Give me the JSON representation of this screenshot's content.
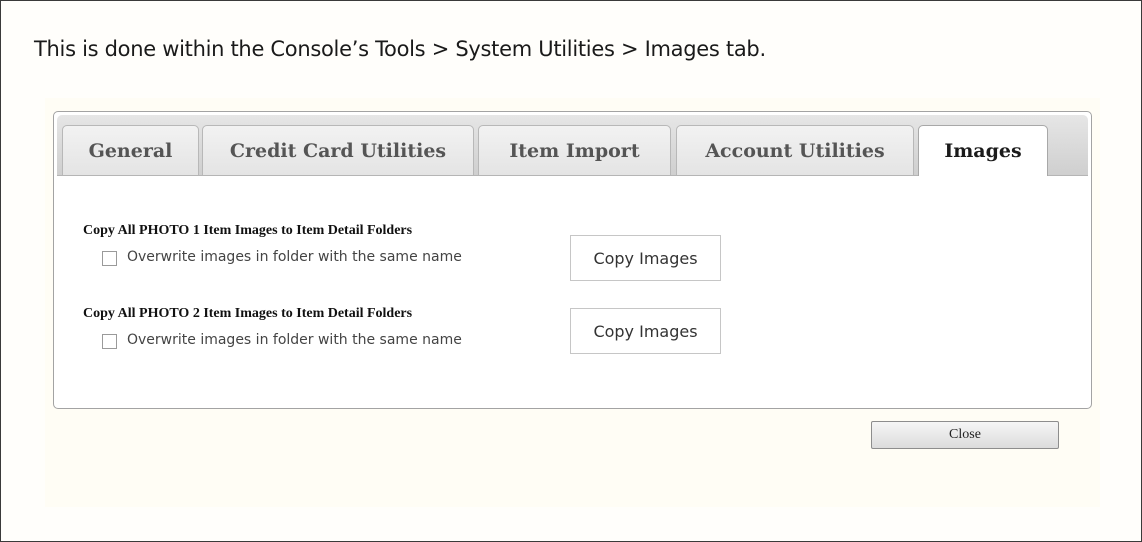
{
  "intro_text": "This is done within the Console’s Tools > System Utilities > Images tab.",
  "tabs": [
    {
      "label": "General",
      "active": false
    },
    {
      "label": "Credit Card Utilities",
      "active": false
    },
    {
      "label": "Item Import",
      "active": false
    },
    {
      "label": "Account Utilities",
      "active": false
    },
    {
      "label": "Images",
      "active": true
    }
  ],
  "sections": [
    {
      "title": "Copy All PHOTO 1 Item Images to Item Detail Folders",
      "checkbox_label": "Overwrite images in folder with the same name",
      "checked": false,
      "button_label": "Copy Images"
    },
    {
      "title": "Copy All PHOTO 2 Item Images to Item Detail Folders",
      "checkbox_label": "Overwrite images in folder with the same name",
      "checked": false,
      "button_label": "Copy Images"
    }
  ],
  "close_label": "Close"
}
